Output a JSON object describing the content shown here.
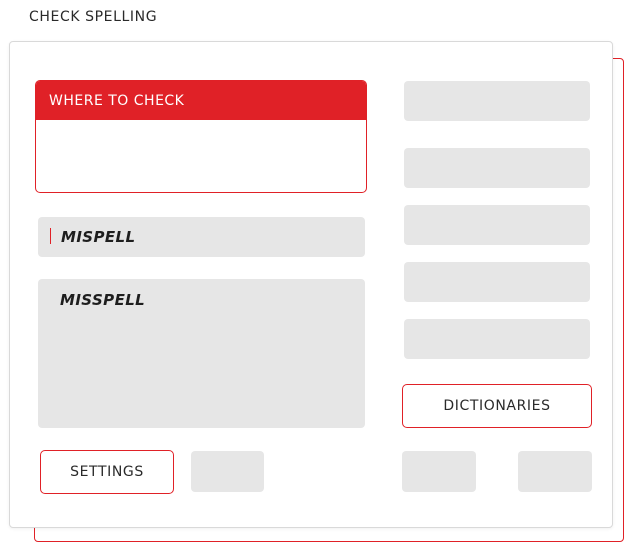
{
  "dialog": {
    "title": "CHECK SPELLING"
  },
  "where_to_check": {
    "label": "WHERE TO CHECK"
  },
  "not_in_dictionary": {
    "value": "MISPELL"
  },
  "suggestions": {
    "items": [
      "MISSPELL"
    ]
  },
  "buttons": {
    "dictionaries": "DICTIONARIES",
    "settings": "SETTINGS"
  },
  "colors": {
    "accent": "#e02127",
    "placeholder": "#e6e6e6",
    "panel_border": "#d9d9d9",
    "text": "#1e1e1e"
  }
}
